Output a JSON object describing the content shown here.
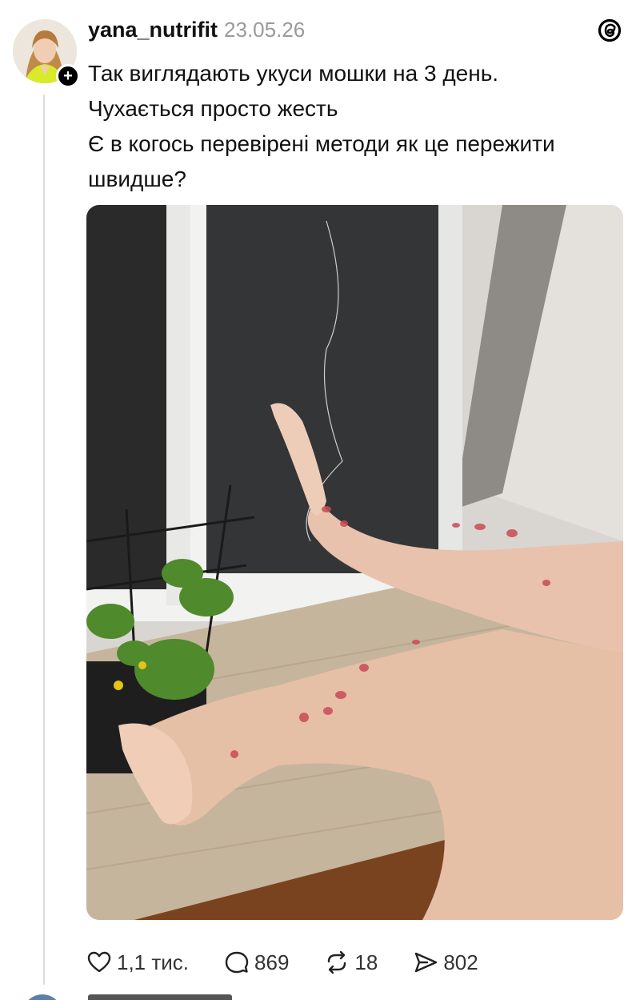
{
  "post": {
    "username": "yana_nutrifit",
    "timestamp": "23.05.26",
    "follow_symbol": "+",
    "text_lines": [
      "Так виглядають укуси мошки на 3 день.",
      "Чухається просто жесть",
      "Є в когось перевірені методи як це пережити швидше?"
    ],
    "image_icon": "photo"
  },
  "actions": {
    "likes": "1,1 тис.",
    "comments": "869",
    "reposts": "18",
    "shares": "802"
  },
  "icons": {
    "like": "heart-icon",
    "comment": "comment-bubble-icon",
    "repost": "repost-icon",
    "share": "send-icon",
    "app": "threads-logo-icon"
  }
}
